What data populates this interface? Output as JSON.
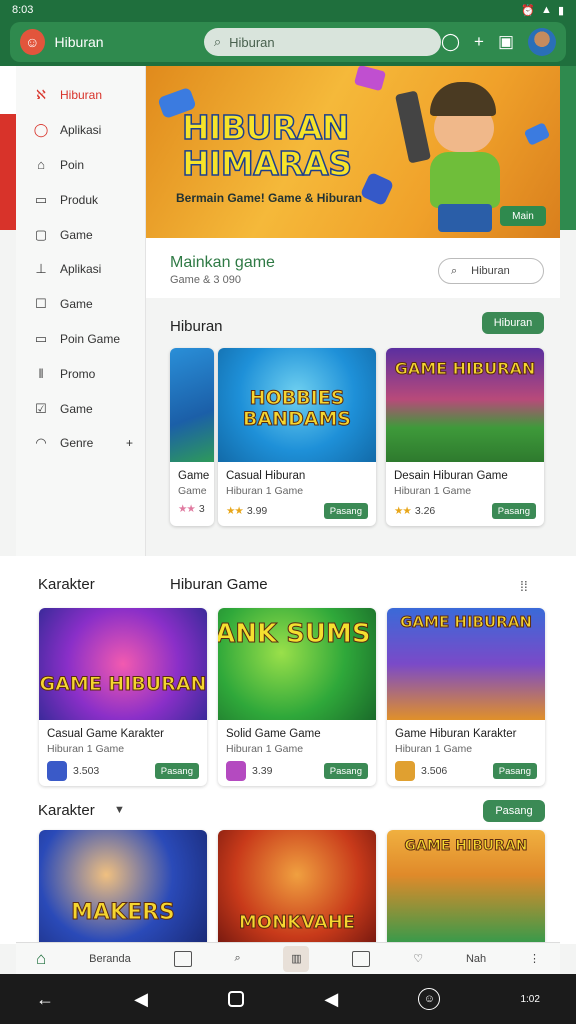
{
  "status": {
    "time": "8:03"
  },
  "app": {
    "title": "Hiburan",
    "search_value": "Hiburan"
  },
  "colors": {
    "brand_green": "#1f6f3d",
    "accent_green": "#3b8a55",
    "accent_red": "#d8332a"
  },
  "drawer": {
    "items": [
      {
        "label": "Hiburan",
        "icon": "gamepad-icon"
      },
      {
        "label": "Aplikasi",
        "icon": "circle-icon"
      },
      {
        "label": "Poin",
        "icon": "tag-icon"
      },
      {
        "label": "Produk",
        "icon": "box-icon"
      },
      {
        "label": "Game",
        "icon": "square-icon"
      },
      {
        "label": "Aplikasi",
        "icon": "chart-icon"
      },
      {
        "label": "Game",
        "icon": "edit-icon"
      },
      {
        "label": "Poin Game",
        "icon": "chat-icon"
      },
      {
        "label": "Promo",
        "icon": "pause-icon"
      },
      {
        "label": "Game",
        "icon": "check-icon"
      },
      {
        "label": "Genre",
        "icon": "folder-icon"
      }
    ]
  },
  "hero": {
    "title_line1": "HIBURAN",
    "title_line2": "HIMARAS",
    "subtitle": "Bermain Game! Game & Hiburan",
    "button": "Main"
  },
  "info": {
    "title": "Mainkan game",
    "subtitle": "Game & 3 090",
    "search_label": "Hiburan"
  },
  "featured": {
    "title": "Hiburan",
    "pill": "Hiburan",
    "cards": [
      {
        "name": "Game",
        "meta": "Game",
        "rating": "3",
        "thumb_title": ""
      },
      {
        "name": "Casual Hiburan",
        "meta": "Hiburan 1 Game",
        "rating": "3.99",
        "button": "Pasang",
        "thumb_title": "HOBBIES BANDAMS"
      },
      {
        "name": "Desain Hiburan Game",
        "meta": "Hiburan 1 Game",
        "rating": "3.26",
        "button": "Pasang",
        "thumb_title": "GAME HIBURAN"
      }
    ]
  },
  "section2": {
    "title_left": "Karakter",
    "title_right": "Hiburan Game",
    "cards": [
      {
        "name": "Casual Game Karakter",
        "meta": "Hiburan 1 Game",
        "rating": "3.503",
        "button": "Pasang",
        "thumb_title": "GAME HIBURAN"
      },
      {
        "name": "Solid Game Game",
        "meta": "Hiburan 1 Game",
        "rating": "3.39",
        "button": "Pasang",
        "thumb_title": "HANK SUMS"
      },
      {
        "name": "Game Hiburan Karakter",
        "meta": "Hiburan 1 Game",
        "rating": "3.506",
        "button": "Pasang",
        "thumb_title": "GAME HIBURAN"
      }
    ]
  },
  "section3": {
    "title": "Karakter",
    "pill": "Pasang",
    "cards": [
      {
        "thumb_title": "MAKERS"
      },
      {
        "thumb_title": "MONKVAHE"
      },
      {
        "thumb_title": "GAME HIBURAN"
      }
    ]
  },
  "bottomnav": {
    "item2": "Beranda",
    "item7": "Nah"
  },
  "sysnav": {
    "right_text": "1:02"
  }
}
